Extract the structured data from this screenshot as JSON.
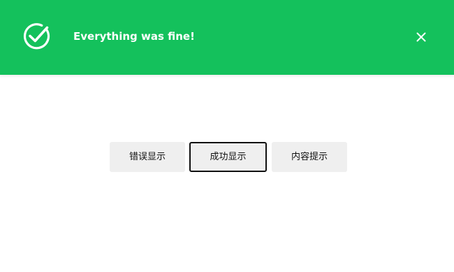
{
  "toast": {
    "message": "Everything was fine!",
    "status_icon": "check-circle-icon",
    "close_icon": "close-icon",
    "background_color": "#14c15c",
    "text_color": "#ffffff"
  },
  "buttons": {
    "error_label": "错误显示",
    "success_label": "成功显示",
    "content_label": "内容提示"
  }
}
